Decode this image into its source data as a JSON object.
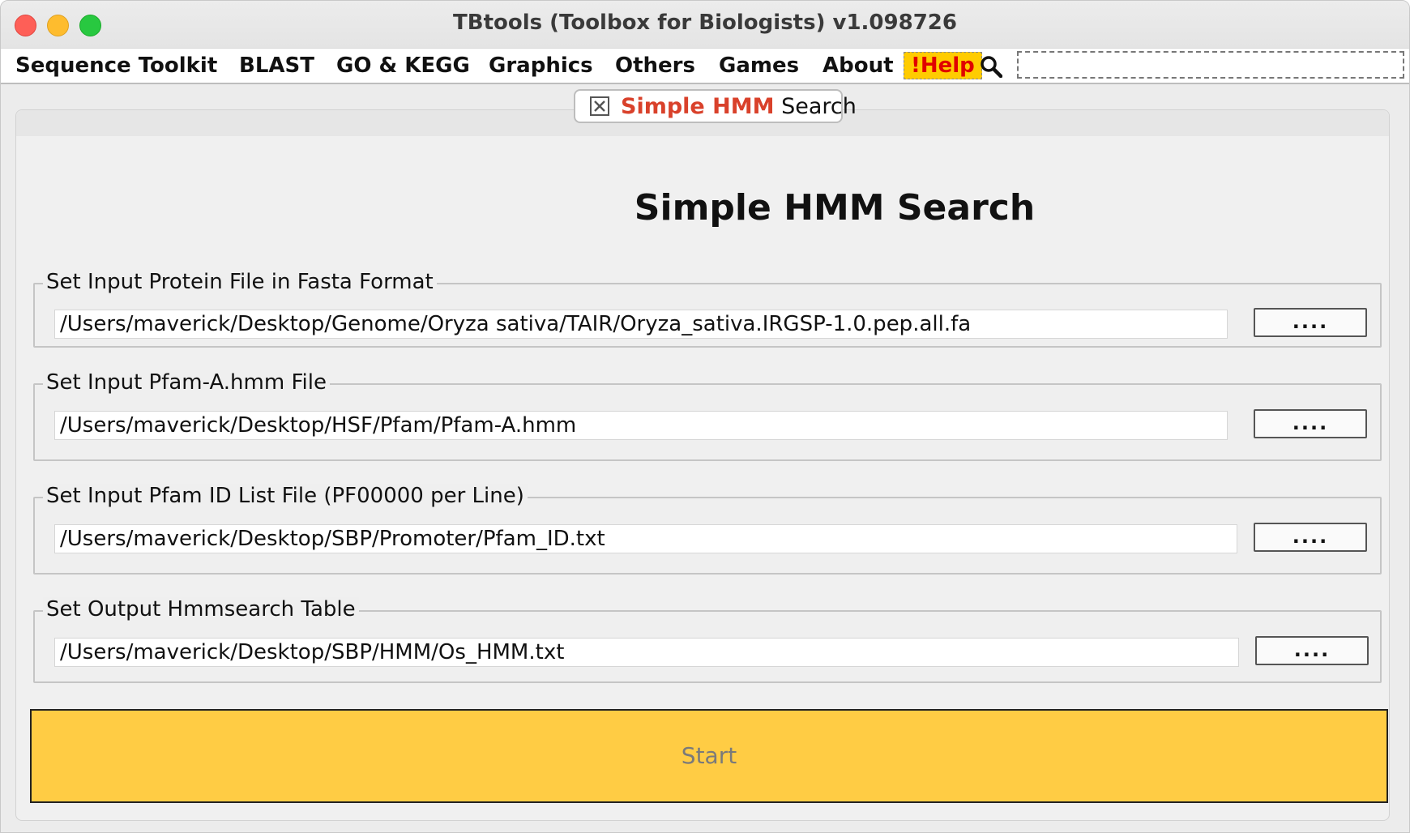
{
  "window": {
    "title": "TBtools (Toolbox for Biologists) v1.098726"
  },
  "menubar": {
    "items": [
      "Sequence Toolkit",
      "BLAST",
      "GO & KEGG",
      "Graphics",
      "Others",
      "Games",
      "About"
    ],
    "help_label": "!Help"
  },
  "tab": {
    "title_accent": "Simple HMM",
    "title_rest": "Search"
  },
  "panel": {
    "heading": "Simple HMM Search",
    "fields": [
      {
        "legend": "Set Input Protein File in Fasta Format",
        "value": "/Users/maverick/Desktop/Genome/Oryza sativa/TAIR/Oryza_sativa.IRGSP-1.0.pep.all.fa",
        "browse_label": "...."
      },
      {
        "legend": "Set Input Pfam-A.hmm File",
        "value": "/Users/maverick/Desktop/HSF/Pfam/Pfam-A.hmm",
        "browse_label": "...."
      },
      {
        "legend": "Set Input Pfam ID List File (PF00000 per Line)",
        "value": "/Users/maverick/Desktop/SBP/Promoter/Pfam_ID.txt",
        "browse_label": "...."
      },
      {
        "legend": "Set Output Hmmsearch Table",
        "value": "/Users/maverick/Desktop/SBP/HMM/Os_HMM.txt",
        "browse_label": "...."
      }
    ],
    "start_label": "Start"
  },
  "colors": {
    "help_bg": "#ffcc00",
    "help_text": "#e00000",
    "tab_accent": "#d9412b",
    "start_bg": "#ffcc44"
  }
}
